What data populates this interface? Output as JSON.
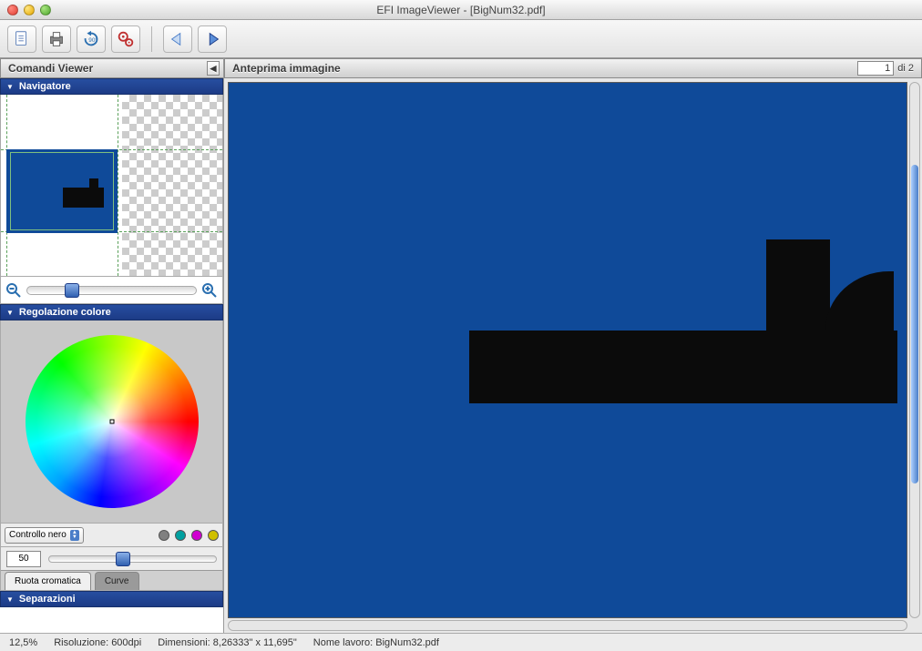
{
  "window": {
    "title": "EFI ImageViewer - [BigNum32.pdf]"
  },
  "toolbar": {
    "icons": [
      "document-icon",
      "print-icon",
      "refresh-icon",
      "gear-icon",
      "back-icon",
      "forward-icon"
    ]
  },
  "left_panel": {
    "title": "Comandi Viewer",
    "navigator": {
      "title": "Navigatore"
    },
    "color_adjust": {
      "title": "Regolazione colore",
      "select_label": "Controllo nero",
      "dots": [
        "#808080",
        "#00a0a0",
        "#d000d0",
        "#d0c000"
      ],
      "value": "50",
      "tabs": {
        "wheel": "Ruota cromatica",
        "curve": "Curve"
      }
    },
    "separations": {
      "title": "Separazioni"
    }
  },
  "right_panel": {
    "title": "Anteprima immagine",
    "page_current": "1",
    "page_total_label": "di 2"
  },
  "status": {
    "zoom": "12,5%",
    "resolution_label": "Risoluzione:",
    "resolution_value": "600dpi",
    "dimensions_label": "Dimensioni:",
    "dimensions_value": "8,26333\" x 11,695\"",
    "jobname_label": "Nome lavoro:",
    "jobname_value": "BigNum32.pdf"
  },
  "colors": {
    "page_blue": "#0f4a99"
  }
}
